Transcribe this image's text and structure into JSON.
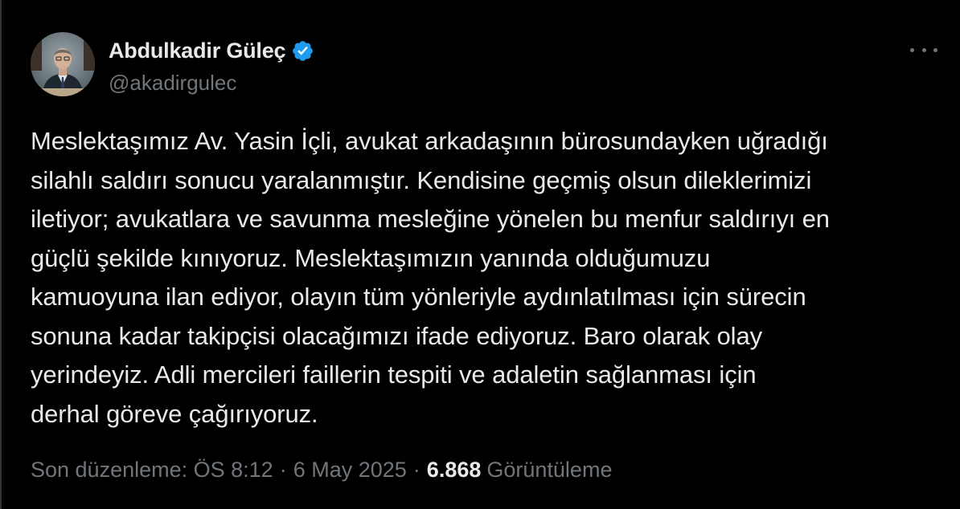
{
  "tweet": {
    "author": {
      "display_name": "Abdulkadir Güleç",
      "handle": "@akadirgulec",
      "verified": true,
      "avatar_icon": "profile-photo",
      "verified_icon": "verified-badge-icon"
    },
    "more_icon": "more-options-icon",
    "text": "Meslektaşımız Av. Yasin İçli, avukat arkadaşının bürosundayken uğradığı\nsilahlı saldırı sonucu yaralanmıştır. Kendisine geçmiş olsun dileklerimizi\niletiyor; avukatlara ve savunma mesleğine yönelen bu menfur saldırıyı en\ngüçlü şekilde kınıyoruz. Meslektaşımızın yanında olduğumuzu\nkamuoyuna ilan ediyor, olayın tüm yönleriyle aydınlatılması için sürecin\nsonuna kadar takipçisi olacağımızı ifade ediyoruz. Baro olarak olay\nyerindeyiz. Adli mercileri faillerin tespiti ve adaletin sağlanması için\nderhal göreve çağırıyoruz.",
    "meta": {
      "edited_label": "Son düzenleme: ÖS 8:12",
      "separator": "·",
      "date": "6 May 2025",
      "views_count": "6.868",
      "views_label": "Görüntüleme"
    }
  },
  "colors": {
    "background": "#000000",
    "primary_text": "#e7e9ea",
    "secondary_text": "#71767b",
    "verified_blue": "#1d9bf0"
  }
}
